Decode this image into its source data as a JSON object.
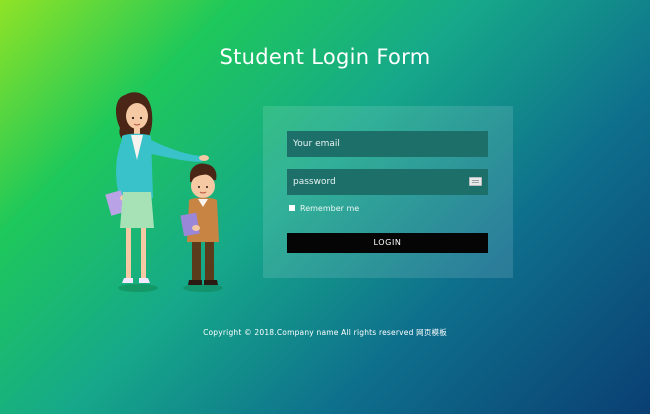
{
  "page": {
    "title": "Student Login Form"
  },
  "form": {
    "email_placeholder": "Your email",
    "password_placeholder": "password",
    "remember_label": "Remember me",
    "remember_checked": false,
    "login_label": "LOGIN"
  },
  "footer": {
    "copyright": "Copyright © 2018.Company name All rights reserved 网页模板"
  },
  "colors": {
    "gradient_start": "#8fe326",
    "gradient_end": "#0a3f73",
    "field_background": "#1d6f6a",
    "button_background": "#050505"
  },
  "icons": {
    "password_field": "keyboard-icon"
  }
}
